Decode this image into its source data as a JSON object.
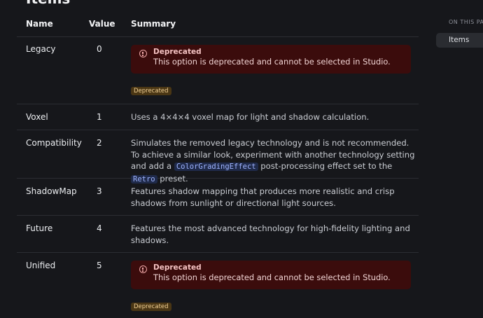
{
  "section": {
    "heading": "Items"
  },
  "table": {
    "headers": {
      "name": "Name",
      "value": "Value",
      "summary": "Summary"
    },
    "rows": [
      {
        "name": "Legacy",
        "value": "0",
        "callout": {
          "title": "Deprecated",
          "body": "This option is deprecated and cannot be selected in Studio."
        },
        "badge": "Deprecated"
      },
      {
        "name": "Voxel",
        "value": "1",
        "summary": "Uses a 4×4×4 voxel map for light and shadow calculation."
      },
      {
        "name": "Compatibility",
        "value": "2",
        "summary_parts": {
          "text1": "Simulates the removed legacy technology and is not recommended. To achieve a similar look, experiment with another technology setting and add a",
          "code1": "ColorGradingEffect",
          "text2": "post-processing effect set to the",
          "code2": "Retro",
          "text3": "preset."
        }
      },
      {
        "name": "ShadowMap",
        "value": "3",
        "summary": "Features shadow mapping that produces more realistic and crisp shadows from sunlight or directional light sources."
      },
      {
        "name": "Future",
        "value": "4",
        "summary": "Features the most advanced technology for high-fidelity lighting and shadows."
      },
      {
        "name": "Unified",
        "value": "5",
        "callout": {
          "title": "Deprecated",
          "body": "This option is deprecated and cannot be selected in Studio."
        },
        "badge": "Deprecated"
      }
    ]
  },
  "toc": {
    "label": "ON THIS PAGE",
    "items": [
      {
        "label": "Items",
        "active": true
      }
    ]
  },
  "colors": {
    "background": "#16171b",
    "callout_bg": "#3b0c0c",
    "badge_bg": "#4a3614",
    "code_fg": "#9fb4ff"
  }
}
